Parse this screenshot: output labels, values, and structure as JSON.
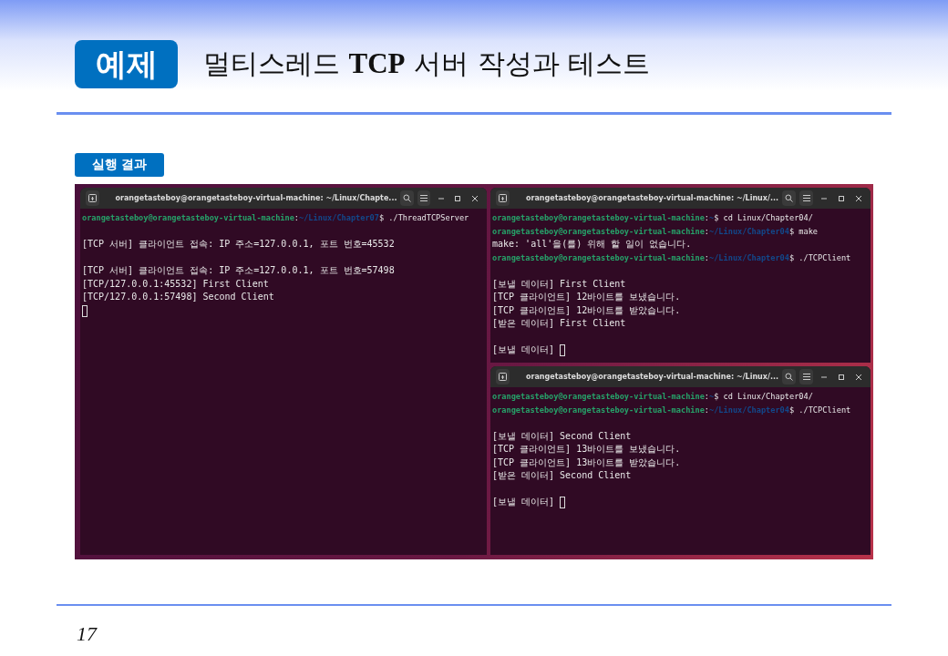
{
  "slide": {
    "badge": "예제",
    "title": "멀티스레드 **TCP** 서버 작성과 테스트",
    "section_label": "실행 결과",
    "page_number": "17"
  },
  "terminals": [
    {
      "title": "orangetasteboy@orangetasteboy-virtual-machine: ~/Linux/Chapte...",
      "lines": [
        {
          "kind": "prompt",
          "user": "orangetasteboy@orangetasteboy-virtual-machine",
          "sep": ":",
          "path": "~/Linux/Chapter07",
          "command": "$ ./ThreadTCPServer"
        },
        {
          "kind": "blank"
        },
        {
          "kind": "output",
          "text": "[TCP 서버] 클라이언트 접속: IP 주소=127.0.0.1, 포트 번호=45532"
        },
        {
          "kind": "blank"
        },
        {
          "kind": "output",
          "text": "[TCP 서버] 클라이언트 접속: IP 주소=127.0.0.1, 포트 번호=57498"
        },
        {
          "kind": "output",
          "text": "[TCP/127.0.0.1:45532] First Client"
        },
        {
          "kind": "output",
          "text": "[TCP/127.0.0.1:57498] Second Client"
        },
        {
          "kind": "cursor"
        }
      ]
    },
    {
      "title": "orangetasteboy@orangetasteboy-virtual-machine: ~/Linux/...",
      "lines": [
        {
          "kind": "prompt",
          "user": "orangetasteboy@orangetasteboy-virtual-machine",
          "sep": ":",
          "path": "~",
          "command": "$ cd Linux/Chapter04/"
        },
        {
          "kind": "prompt",
          "user": "orangetasteboy@orangetasteboy-virtual-machine",
          "sep": ":",
          "path": "~/Linux/Chapter04",
          "command": "$ make"
        },
        {
          "kind": "output",
          "text": "make: 'all'을(를) 위해 할 일이 없습니다."
        },
        {
          "kind": "prompt",
          "user": "orangetasteboy@orangetasteboy-virtual-machine",
          "sep": ":",
          "path": "~/Linux/Chapter04",
          "command": "$ ./TCPClient"
        },
        {
          "kind": "blank"
        },
        {
          "kind": "output",
          "text": "[보낼 데이터] First Client"
        },
        {
          "kind": "output",
          "text": "[TCP 클라이언트] 12바이트를 보냈습니다."
        },
        {
          "kind": "output",
          "text": "[TCP 클라이언트] 12바이트를 받았습니다."
        },
        {
          "kind": "output",
          "text": "[받은 데이터] First Client"
        },
        {
          "kind": "blank"
        },
        {
          "kind": "input",
          "text": "[보낼 데이터]"
        }
      ]
    },
    {
      "title": "orangetasteboy@orangetasteboy-virtual-machine: ~/Linux/...",
      "lines": [
        {
          "kind": "prompt",
          "user": "orangetasteboy@orangetasteboy-virtual-machine",
          "sep": ":",
          "path": "~",
          "command": "$ cd Linux/Chapter04/"
        },
        {
          "kind": "prompt",
          "user": "orangetasteboy@orangetasteboy-virtual-machine",
          "sep": ":",
          "path": "~/Linux/Chapter04",
          "command": "$ ./TCPClient"
        },
        {
          "kind": "blank"
        },
        {
          "kind": "output",
          "text": "[보낼 데이터] Second Client"
        },
        {
          "kind": "output",
          "text": "[TCP 클라이언트] 13바이트를 보냈습니다."
        },
        {
          "kind": "output",
          "text": "[TCP 클라이언트] 13바이트를 받았습니다."
        },
        {
          "kind": "output",
          "text": "[받은 데이터] Second Client"
        },
        {
          "kind": "blank"
        },
        {
          "kind": "input",
          "text": "[보낼 데이터]"
        }
      ]
    }
  ]
}
